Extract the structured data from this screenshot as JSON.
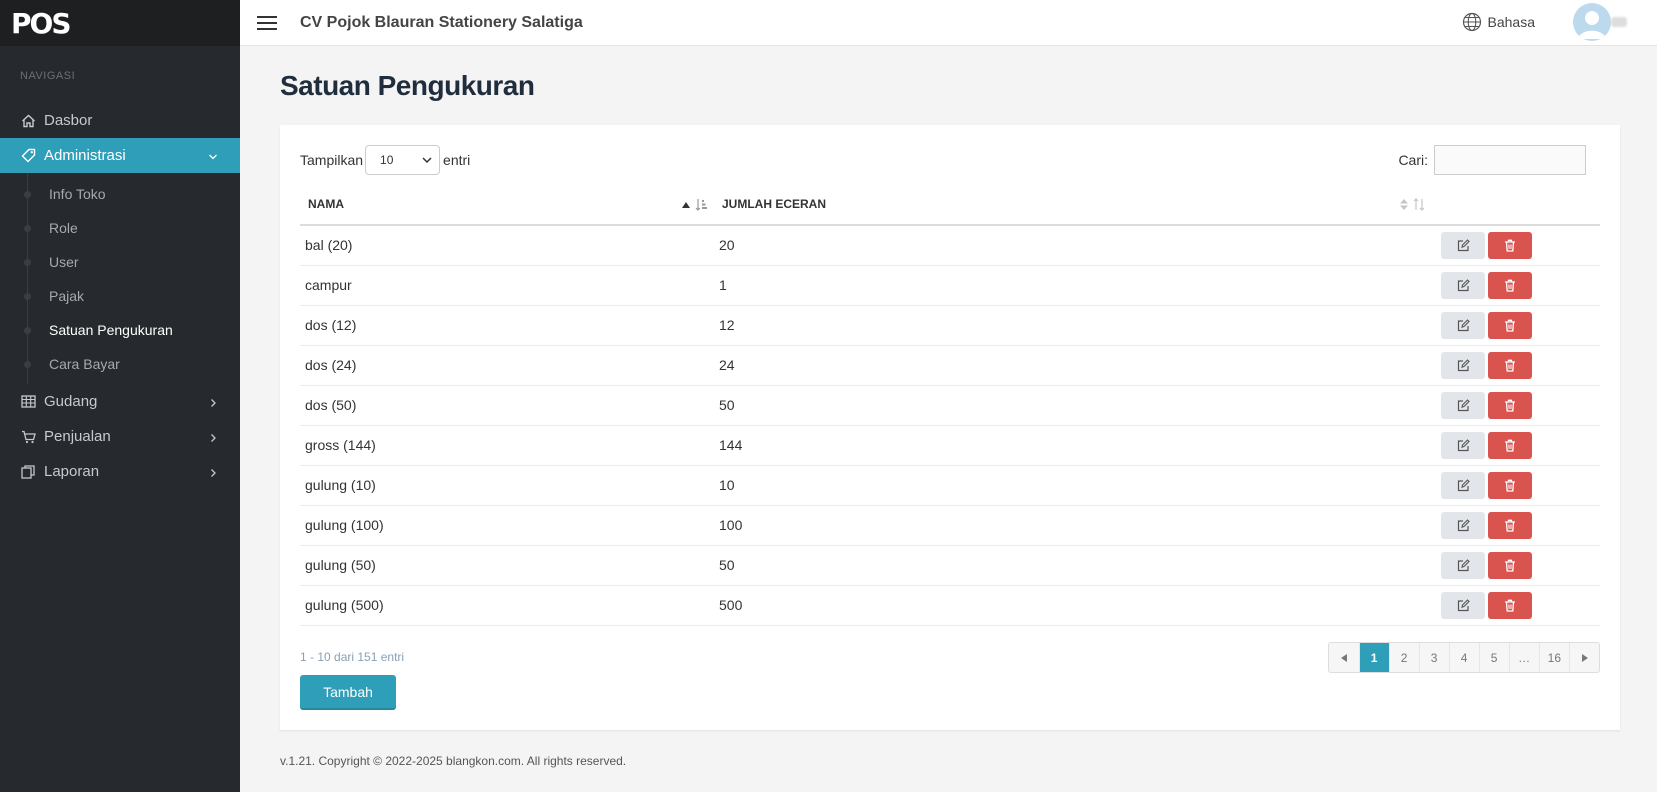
{
  "app": {
    "brand": "POS",
    "company": "CV Pojok Blauran Stationery Salatiga",
    "language_label": "Bahasa"
  },
  "sidebar": {
    "heading": "NAVIGASI",
    "items": {
      "dasbor": "Dasbor",
      "administrasi": "Administrasi",
      "gudang": "Gudang",
      "penjualan": "Penjualan",
      "laporan": "Laporan"
    },
    "admin_sub": [
      "Info Toko",
      "Role",
      "User",
      "Pajak",
      "Satuan Pengukuran",
      "Cara Bayar"
    ],
    "current_sub": "Satuan Pengukuran"
  },
  "page": {
    "title": "Satuan Pengukuran"
  },
  "table_controls": {
    "show_label": "Tampilkan",
    "page_size": "10",
    "entries_label": "entri",
    "search_label": "Cari:",
    "search_value": ""
  },
  "table": {
    "headers": {
      "nama": "NAMA",
      "jumlah": "JUMLAH ECERAN"
    },
    "rows": [
      {
        "nama": "bal (20)",
        "jumlah": "20"
      },
      {
        "nama": "campur",
        "jumlah": "1"
      },
      {
        "nama": "dos (12)",
        "jumlah": "12"
      },
      {
        "nama": "dos (24)",
        "jumlah": "24"
      },
      {
        "nama": "dos (50)",
        "jumlah": "50"
      },
      {
        "nama": "gross (144)",
        "jumlah": "144"
      },
      {
        "nama": "gulung (10)",
        "jumlah": "10"
      },
      {
        "nama": "gulung (100)",
        "jumlah": "100"
      },
      {
        "nama": "gulung (50)",
        "jumlah": "50"
      },
      {
        "nama": "gulung (500)",
        "jumlah": "500"
      }
    ]
  },
  "pagination": {
    "info": "1 - 10 dari 151 entri",
    "pages": [
      "1",
      "2",
      "3",
      "4",
      "5",
      "…",
      "16"
    ],
    "current": "1"
  },
  "buttons": {
    "add": "Tambah"
  },
  "footer": {
    "text": "v.1.21. Copyright © 2022-2025 blangkon.com. All rights reserved."
  },
  "colors": {
    "accent": "#2f9eb8",
    "danger": "#d9534f",
    "sidebar_bg": "#26292d"
  },
  "icons": {
    "edit": "edit-icon",
    "delete": "trash-icon"
  }
}
